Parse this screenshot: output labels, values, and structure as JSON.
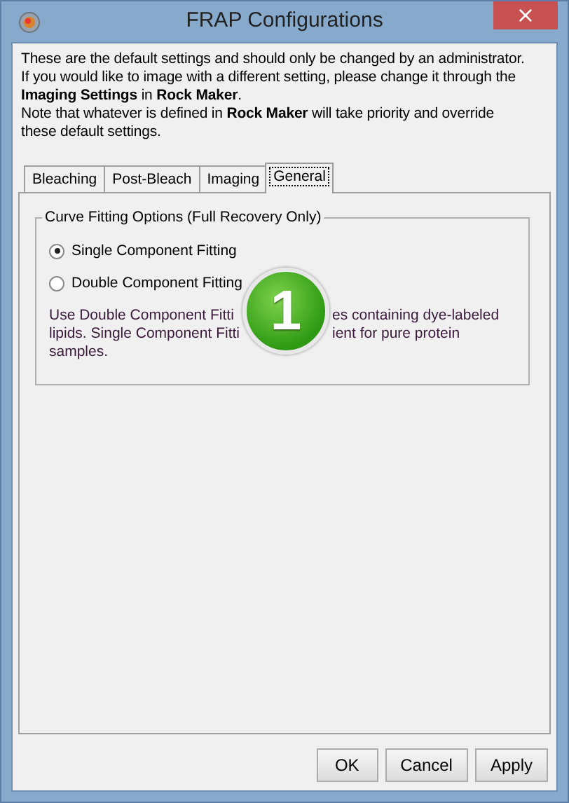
{
  "window": {
    "title": "FRAP Configurations",
    "close": "×"
  },
  "notice": [
    "These are the default settings and should only be changed by an administrator.",
    "If you would like to image with a different setting, please change it through the",
    "**Imaging Settings** in **Rock Maker**.",
    "Note that whatever is defined in **Rock Maker** will take priority and override",
    "these default settings."
  ],
  "tabs": [
    {
      "label": "Bleaching",
      "selected": false
    },
    {
      "label": "Post-Bleach",
      "selected": false
    },
    {
      "label": "Imaging",
      "selected": false
    },
    {
      "label": "General",
      "selected": true
    }
  ],
  "group": {
    "title": "Curve Fitting Options (Full Recovery Only)",
    "options": [
      {
        "label": "Single Component Fitting",
        "selected": true
      },
      {
        "label": "Double Component Fitting",
        "selected": false
      }
    ],
    "description": [
      {
        "segments": [
          "Use Double Component Fitti",
          "es containing dye-labeled"
        ]
      },
      {
        "segments": [
          "lipids. Single Component Fitti",
          "ient for pure protein"
        ]
      },
      {
        "segments": [
          "samples."
        ]
      }
    ]
  },
  "badge": {
    "label": "1"
  },
  "buttons": [
    "OK",
    "Cancel",
    "Apply"
  ]
}
